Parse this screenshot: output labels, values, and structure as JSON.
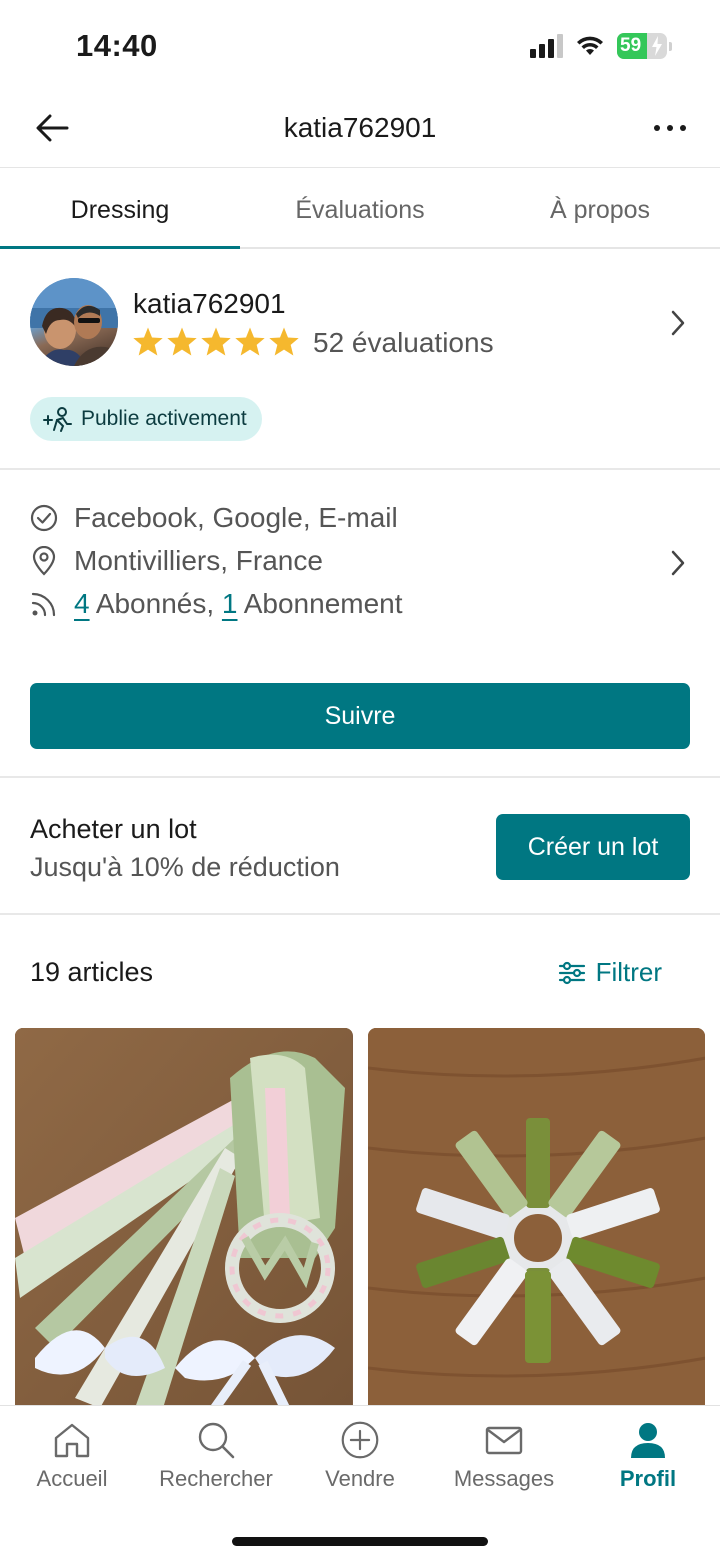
{
  "status_bar": {
    "time": "14:40",
    "battery": "59"
  },
  "header": {
    "title": "katia762901"
  },
  "tabs": [
    {
      "label": "Dressing",
      "active": true
    },
    {
      "label": "Évaluations",
      "active": false
    },
    {
      "label": "À propos",
      "active": false
    }
  ],
  "profile": {
    "username": "katia762901",
    "rating_stars": 5,
    "rating_count": "52 évaluations",
    "badge": "Publie activement"
  },
  "info": {
    "verified": "Facebook, Google, E-mail",
    "location": "Montivilliers, France",
    "followers_count": "4",
    "followers_label": " Abonnés, ",
    "following_count": "1",
    "following_label": " Abonnement"
  },
  "follow_button": "Suivre",
  "bundle": {
    "title": "Acheter un lot",
    "subtitle": "Jusqu'à 10% de réduction",
    "button": "Créer un lot"
  },
  "articles": {
    "count": "19 articles",
    "filter": "Filtrer"
  },
  "bottom_nav": [
    {
      "label": "Accueil",
      "icon": "home-icon",
      "active": false
    },
    {
      "label": "Rechercher",
      "icon": "search-icon",
      "active": false
    },
    {
      "label": "Vendre",
      "icon": "plus-circle-icon",
      "active": false
    },
    {
      "label": "Messages",
      "icon": "mail-icon",
      "active": false
    },
    {
      "label": "Profil",
      "icon": "profile-icon",
      "active": true
    }
  ],
  "colors": {
    "accent": "#007782",
    "star": "#f5b82e",
    "badge_bg": "#d6f2f1"
  }
}
